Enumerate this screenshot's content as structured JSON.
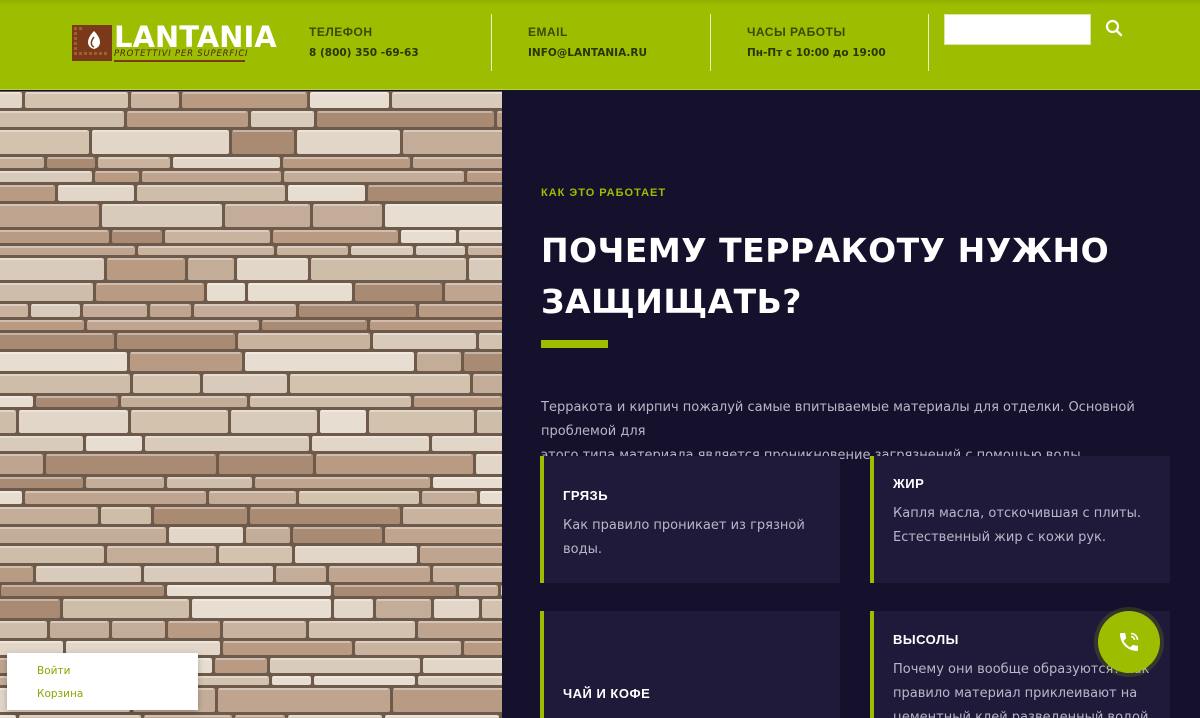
{
  "brand": {
    "name": "LANTANIA",
    "tagline": "PROTETTIVI PER SUPERFICI",
    "accent_color": "#9dbd00",
    "dark_bg": "#15112c"
  },
  "header": {
    "phone": {
      "label": "ТЕЛЕФОН",
      "value": "8 (800) 350 -69-63"
    },
    "email": {
      "label": "EMAIL",
      "value": "INFO@LANTANIA.RU"
    },
    "hours": {
      "label": "ЧАСЫ РАБОТЫ",
      "value": "Пн-Пт с 10:00 до 19:00"
    },
    "search": {
      "placeholder": "",
      "value": "",
      "icon": "search-icon"
    }
  },
  "section": {
    "eyebrow": "КАК ЭТО РАБОТАЕТ",
    "title_line1": "ПОЧЕМУ ТЕРРАКОТУ НУЖНО",
    "title_line2": "ЗАЩИЩАТЬ?",
    "lead_line1": "Терракота и кирпич пожалуй самые впитываемые материалы для отделки. Основной проблемой для",
    "lead_line2": "этого типа материала является проникновение загрязнений с помощью воды.",
    "cards": [
      {
        "title": "ГРЯЗЬ",
        "text": "Как правило проникает из грязной воды."
      },
      {
        "title": "ЖИР",
        "text_line1": "Капля масла, отскочившая с плиты.",
        "text_line2": "Естественный жир с кожи рук."
      },
      {
        "title": "ЧАЙ И КОФЕ"
      },
      {
        "title": "ВЫСОЛЫ",
        "text_line1": "Почему они вообще образуются? Как",
        "text_line2": "правило материал приклеивают на",
        "text_line3": "цементный клей разведенный водой."
      }
    ]
  },
  "widgets": {
    "call_icon": "phone-icon",
    "login_label": "Войти",
    "cart_label": "Корзина"
  }
}
